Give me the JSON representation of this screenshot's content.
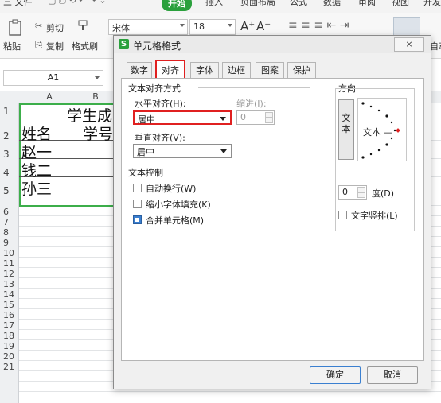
{
  "menubar": {
    "items": [
      "三 文件",
      "开始",
      "插入",
      "页面布局",
      "公式",
      "数据",
      "审阅",
      "视图",
      "开发"
    ],
    "active": "开始"
  },
  "ribbon": {
    "paste": "粘贴",
    "cut": "剪切",
    "copy": "复制",
    "format_painter": "格式刷",
    "font_name": "宋体",
    "font_size": "18",
    "auto_label": "自动"
  },
  "namebox": {
    "value": "A1"
  },
  "columns": [
    "A",
    "B"
  ],
  "rows": [
    "1",
    "2",
    "3",
    "4",
    "5",
    "6",
    "7",
    "8",
    "9",
    "10",
    "11",
    "12",
    "13",
    "14",
    "15",
    "16",
    "17",
    "18",
    "19",
    "20",
    "21"
  ],
  "cells": {
    "title": "学生成",
    "name_header": "姓名",
    "id_header": "学号",
    "r3": "赵一",
    "r4": "钱二",
    "r5": "孙三"
  },
  "dialog": {
    "title": "单元格格式",
    "close": "⨯",
    "tabs": [
      "数字",
      "对齐",
      "字体",
      "边框",
      "图案",
      "保护"
    ],
    "selected_tab": "对齐",
    "text_align_section": "文本对齐方式",
    "horizontal_label": "水平对齐(H):",
    "horizontal_value": "居中",
    "indent_label": "缩进(I):",
    "indent_value": "0",
    "vertical_label": "垂直对齐(V):",
    "vertical_value": "居中",
    "text_control_section": "文本控制",
    "wrap_text": "自动换行(W)",
    "shrink_to_fit": "缩小字体填充(K)",
    "merge_cells": "合并单元格(M)",
    "orientation_section": "方向",
    "vertical_text_button": "文本",
    "orientation_sample": "文本 —",
    "degrees_value": "0",
    "degrees_label": "度(D)",
    "vertical_text_check": "文字竖排(L)",
    "ok": "确定",
    "cancel": "取消"
  },
  "colors": {
    "accent_green": "#2aa03c",
    "highlight_red": "#e02020",
    "selection_green": "#3cae4a",
    "checkbox_blue": "#3a7fd0"
  }
}
